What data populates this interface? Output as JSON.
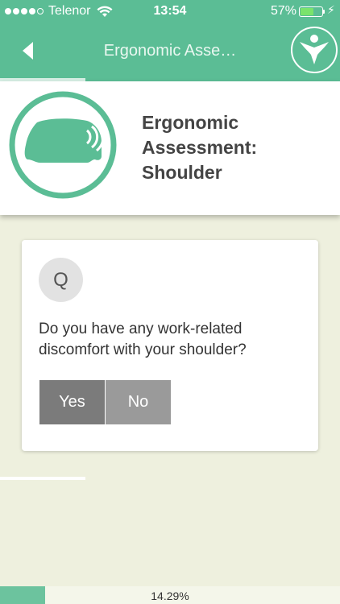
{
  "status_bar": {
    "carrier": "Telenor",
    "time": "13:54",
    "battery_percent_text": "57%",
    "battery_level": 0.57,
    "signal_dots_filled": 4
  },
  "nav": {
    "title": "Ergonomic Asse…",
    "back_icon": "chevron-left-icon",
    "logo_icon": "person-logo-icon"
  },
  "header": {
    "title_line1": "Ergonomic",
    "title_line2": "Assessment:",
    "title_line3": "Shoulder",
    "emblem_icon": "shoulder-icon"
  },
  "question": {
    "badge": "Q",
    "text": "Do you have any work-related discomfort with your shoulder?",
    "answers": {
      "yes": "Yes",
      "no": "No"
    }
  },
  "progress": {
    "label": "14.29%",
    "fraction": 0.1429
  },
  "colors": {
    "accent": "#5bbd95",
    "background": "#eef0de",
    "button_yes": "#7b7b7b",
    "button_no": "#9a9a9a"
  }
}
